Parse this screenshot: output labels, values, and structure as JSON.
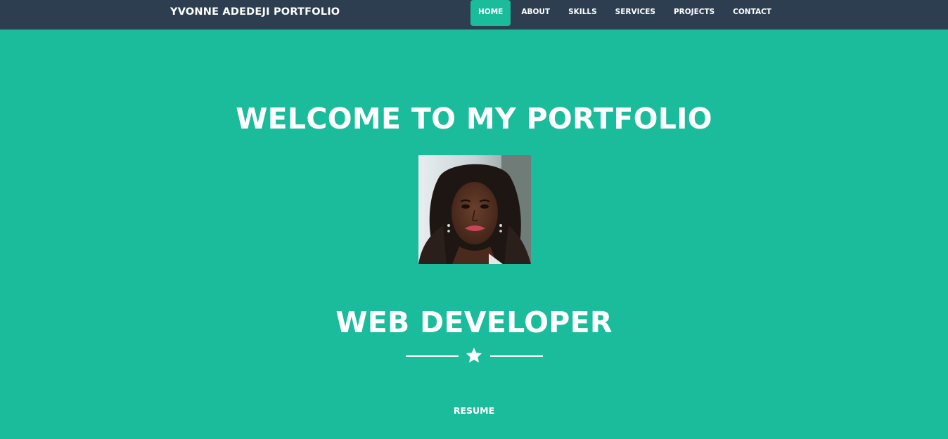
{
  "navbar": {
    "brand": "YVONNE ADEDEJI PORTFOLIO",
    "items": [
      {
        "label": "HOME",
        "active": true
      },
      {
        "label": "ABOUT",
        "active": false
      },
      {
        "label": "SKILLS",
        "active": false
      },
      {
        "label": "SERVICES",
        "active": false
      },
      {
        "label": "PROJECTS",
        "active": false
      },
      {
        "label": "CONTACT",
        "active": false
      }
    ]
  },
  "hero": {
    "title": "WELCOME TO MY PORTFOLIO",
    "role": "WEB DEVELOPER",
    "divider_icon": "star-icon",
    "resume_label": "RESUME"
  },
  "colors": {
    "background": "#1abc9c",
    "navbar": "#2c3e50",
    "active_tab": "#1abc9c",
    "text": "#ffffff"
  }
}
